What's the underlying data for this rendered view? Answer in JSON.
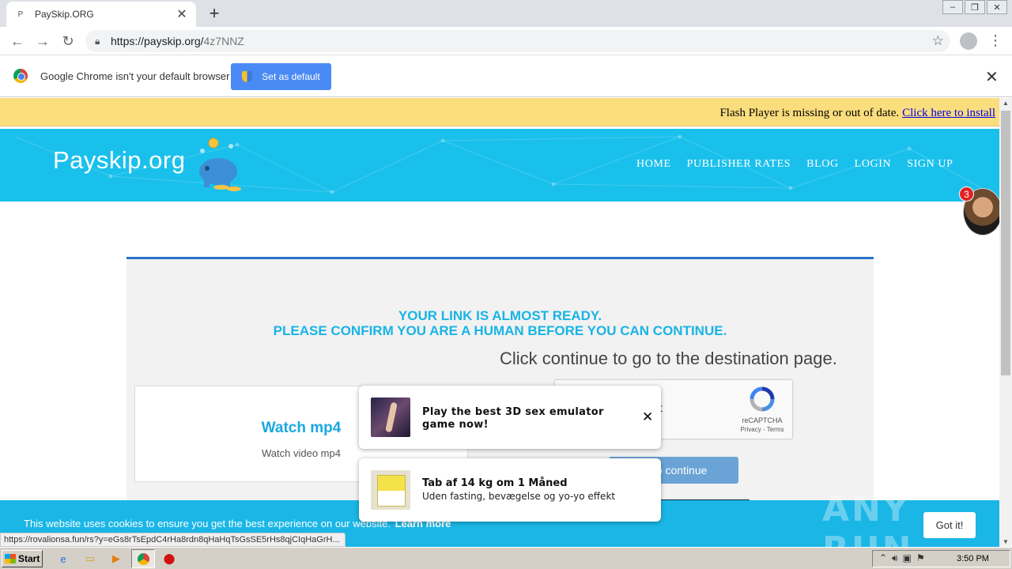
{
  "browser": {
    "tab_title": "PaySkip.ORG",
    "tab_favicon": "P",
    "url_host": "https://payskip.org/",
    "url_path": "4z7NNZ",
    "infobar_message": "Google Chrome isn't your default browser",
    "set_default_label": "Set as default"
  },
  "flash": {
    "message": "Flash Player is missing or out of date.",
    "link": "Click here to install"
  },
  "site": {
    "logo": "Payskip.org",
    "nav": [
      "HOME",
      "PUBLISHER RATES",
      "BLOG",
      "LOGIN",
      "SIGN UP"
    ],
    "chat_badge": "3"
  },
  "card": {
    "ready_line1": "YOUR LINK IS ALMOST READY.",
    "ready_line2": "PLEASE CONFIRM YOU ARE A HUMAN BEFORE YOU CAN CONTINUE.",
    "destination_text": "Click continue to go to the destination page.",
    "watch_title": "Watch mp4",
    "watch_subtitle": "Watch video mp4",
    "captcha_label": "ot",
    "captcha_brand": "reCAPTCHA",
    "captcha_links": "Privacy - Terms",
    "continue_label": "re to continue"
  },
  "popups": [
    {
      "title": "Play the best 3D sex emulator game now!",
      "subtitle": ""
    },
    {
      "title": "Tab af 14 kg om 1 Måned",
      "subtitle": "Uden fasting, bevægelse og yo-yo effekt"
    }
  ],
  "cookie": {
    "text": "This website uses cookies to ensure you get the best experience on our website.",
    "learn_more": "Learn more",
    "got_it": "Got it!"
  },
  "watermark": "ANY RUN",
  "status_url": "https://rovalionsa.fun/rs?y=eGs8rTsEpdC4rHa8rdn8qHaHqTsGsSE5rHs8qjCIqHaGrH...",
  "taskbar": {
    "start_label": "Start",
    "clock": "3:50 PM"
  },
  "colors": {
    "header_blue": "#1ac0ec",
    "ready_text": "#18b4e6",
    "flash_bar": "#fadd7c",
    "card_border": "#2e73c9"
  }
}
